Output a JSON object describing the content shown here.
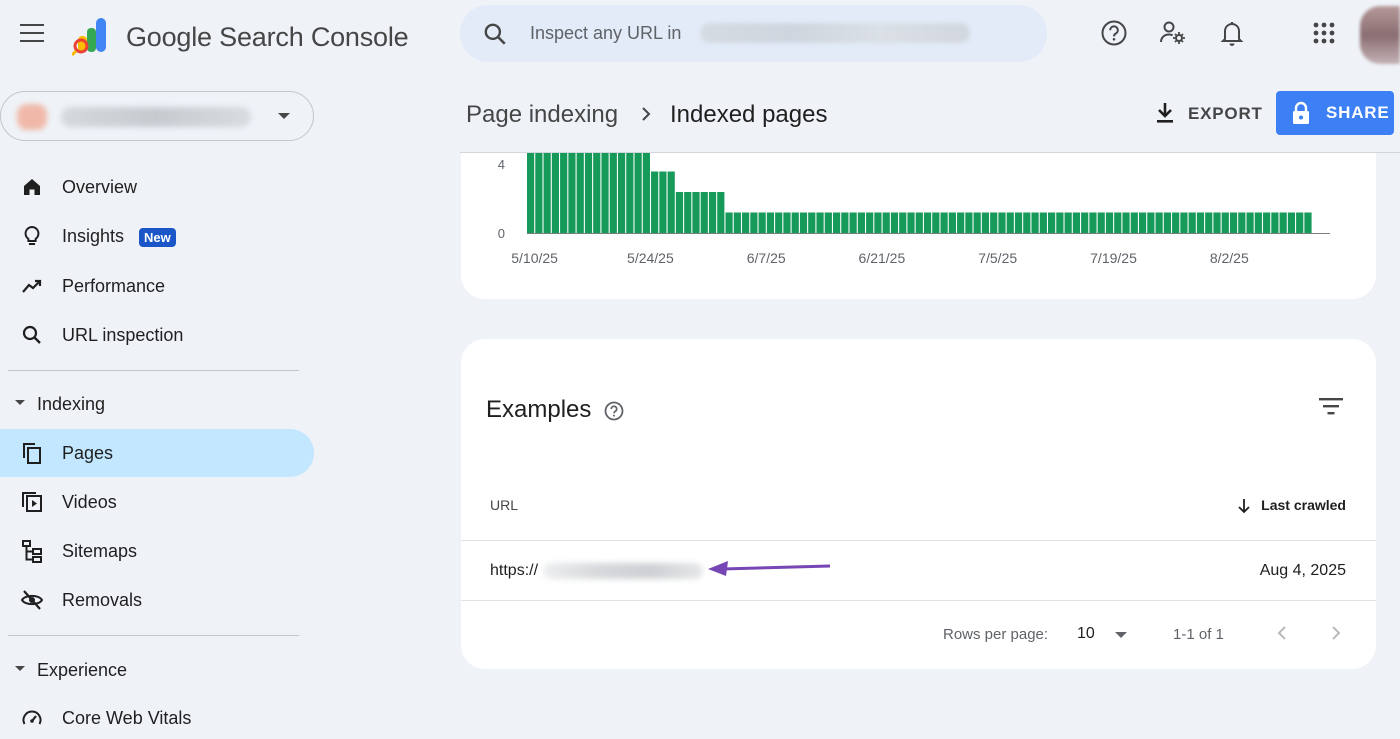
{
  "app": {
    "title": "Google Search Console"
  },
  "search": {
    "placeholder": "Inspect any URL in"
  },
  "sidebar": {
    "items": [
      {
        "label": "Overview",
        "icon": "home-icon"
      },
      {
        "label": "Insights",
        "icon": "lightbulb-icon",
        "badge": "New"
      },
      {
        "label": "Performance",
        "icon": "trending-up-icon"
      },
      {
        "label": "URL inspection",
        "icon": "search-icon"
      }
    ],
    "sections": [
      {
        "label": "Indexing",
        "items": [
          {
            "label": "Pages",
            "icon": "pages-icon",
            "active": true
          },
          {
            "label": "Videos",
            "icon": "video-pages-icon"
          },
          {
            "label": "Sitemaps",
            "icon": "sitemap-icon"
          },
          {
            "label": "Removals",
            "icon": "eye-off-icon"
          }
        ]
      },
      {
        "label": "Experience",
        "items": [
          {
            "label": "Core Web Vitals",
            "icon": "gauge-icon"
          }
        ]
      }
    ]
  },
  "breadcrumb": {
    "parent": "Page indexing",
    "current": "Indexed pages"
  },
  "actions": {
    "export": "EXPORT",
    "share": "SHARE"
  },
  "colors": {
    "bar": "#159a5a",
    "share_bg": "#3d80f5",
    "active_nav": "#c2e7ff",
    "badge": "#1a56c8",
    "annotation_arrow": "#7646b5"
  },
  "chart_data": {
    "type": "bar",
    "title": "",
    "xlabel": "",
    "ylabel": "",
    "ylim": [
      0,
      4
    ],
    "yticks": [
      "0",
      "4"
    ],
    "xticks": [
      "5/10/25",
      "5/24/25",
      "6/7/25",
      "6/21/25",
      "7/5/25",
      "7/19/25",
      "8/2/25"
    ],
    "x_start": "5/10/25",
    "values": [
      4,
      4,
      4,
      4,
      4,
      4,
      4,
      4,
      4,
      4,
      4,
      4,
      4,
      4,
      4,
      3,
      3,
      3,
      2,
      2,
      2,
      2,
      2,
      2,
      1,
      1,
      1,
      1,
      1,
      1,
      1,
      1,
      1,
      1,
      1,
      1,
      1,
      1,
      1,
      1,
      1,
      1,
      1,
      1,
      1,
      1,
      1,
      1,
      1,
      1,
      1,
      1,
      1,
      1,
      1,
      1,
      1,
      1,
      1,
      1,
      1,
      1,
      1,
      1,
      1,
      1,
      1,
      1,
      1,
      1,
      1,
      1,
      1,
      1,
      1,
      1,
      1,
      1,
      1,
      1,
      1,
      1,
      1,
      1,
      1,
      1,
      1,
      1,
      1,
      1,
      1,
      1,
      1,
      1,
      1
    ]
  },
  "examples": {
    "title": "Examples",
    "columns": {
      "url": "URL",
      "last_crawled": "Last crawled"
    },
    "rows": [
      {
        "url": "https://",
        "last_crawled": "Aug 4, 2025"
      }
    ],
    "pagination": {
      "rows_per_page_label": "Rows per page:",
      "rows_per_page": "10",
      "range": "1-1 of 1"
    }
  }
}
